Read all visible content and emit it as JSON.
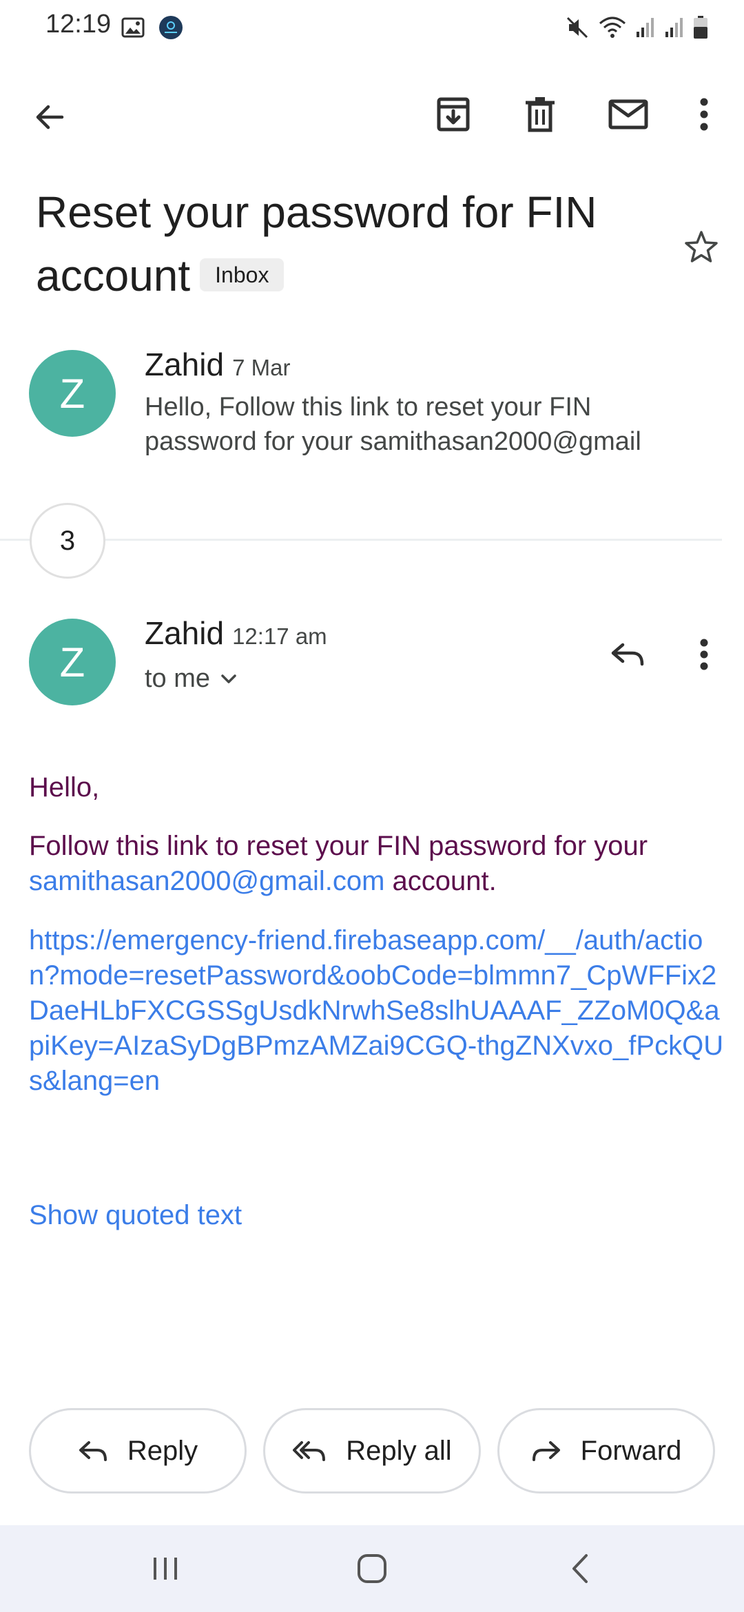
{
  "status_bar": {
    "time": "12:19"
  },
  "toolbar": {
    "back_icon": "arrow-left-icon",
    "archive_icon": "archive-icon",
    "delete_icon": "trash-icon",
    "mark_unread_icon": "mail-icon",
    "more_icon": "more-vert-icon"
  },
  "subject": {
    "text": "Reset your password for FIN account",
    "label": "Inbox"
  },
  "collapsed_message": {
    "avatar_letter": "Z",
    "sender": "Zahid",
    "date": "7 Mar",
    "snippet": "Hello, Follow this link to reset your FIN password for your samithasan2000@gmail"
  },
  "hidden_count": "3",
  "message": {
    "avatar_letter": "Z",
    "sender": "Zahid",
    "time": "12:17 am",
    "recipient": "to me",
    "greeting": "Hello,",
    "line_start": "Follow this link to reset your FIN password for your",
    "email_link": "samithasan2000@gmail.com",
    "line_end": "account.",
    "url": "https://emergency-friend.firebaseapp.com/__/auth/action?mode=resetPassword&oobCode=blmmn7_CpWFFix2DaeHLbFXCGSSgUsdkNrwhSe8slhUAAAF_ZZoM0Q&apiKey=AIzaSyDgBPmzAMZai9CGQ-thgZNXvxo_fPckQUs&lang=en",
    "show_quoted": "Show quoted text"
  },
  "actions": {
    "reply": "Reply",
    "reply_all": "Reply all",
    "forward": "Forward"
  },
  "colors": {
    "avatar": "#4cb3a1",
    "link": "#3b7de8",
    "body_text": "#5c0d4c",
    "navbar": "#eff1f9"
  }
}
